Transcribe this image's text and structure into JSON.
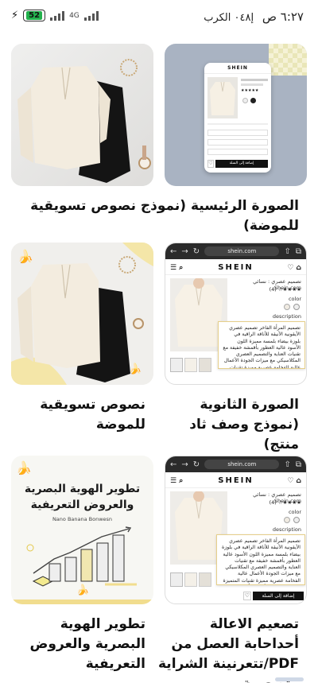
{
  "status_bar": {
    "time": "٦:٢٧ ص",
    "carrier": "إ٠٤٨ الكرب",
    "battery": "52",
    "network": "4G"
  },
  "cards": [
    {
      "id": "main-image",
      "caption": "الصورة الرئيسية (نموذج نصوص تسويقية للموضة)",
      "phone_brand": "SHEIN",
      "buy_label": "إضافة إلى السلة"
    },
    {
      "id": "product-photo-1"
    },
    {
      "id": "secondary-image",
      "caption": "الصورة الثانوية (نموذج وصف ثاد منتج)",
      "url": "shein.com",
      "brand": "SHEIN",
      "product_title": "تصميم عصري : نسائي Shein.com",
      "rating": "★★★★☆ (4)",
      "color_label": "color",
      "description_label": "description",
      "description": "تصميم المرأة الفاخر تصميم عصري الأيقونية الأنيقة للأناقة الراقية في بلوزة بيضاء بلمسة مميزة اللون الأسود عالية العطور بأقمشة خفيفة مع تقنيات العناية والتصميم العصري المكلاسيكي مع ميزات الجودة الأعمال عالية الفخامة عصرية مميزة تقنيات المتميزة تصميم عصري، الأعمال وأناقة عالية التصميم الراقي. الأنيق، أسود."
    },
    {
      "id": "product-photo-2",
      "caption": "نصوص تسويقية للموضة"
    },
    {
      "id": "pdf-design",
      "caption": "تصعيم الاعالة أحداحابة العصل من PDF/تتعرنينة الشراية وتصعرية",
      "url": "shein.com",
      "brand": "SHEIN",
      "product_title": "تصميم عصري : نسائي Shein.com",
      "rating": "★★★★☆ (4)",
      "color_label": "color",
      "description_label": "description",
      "description": "تصميم المرأة الفاخر تصميم عصري الأيقونية الأنيقة للأناقة الراقية في بلوزة بيضاء بلمسة مميزة اللون الأسود عالية العطور بأقمشة خفيفة مع تقنيات العناية والتصميم العصري المكلاسيكي مع ميزات الجودة الأعمال عالية الفخامة عصرية مميزة تقنيات المتميزة تصميم عصري، الأعمال وأناقة عالية التصميم الراقي.",
      "buy_label": "إضافة إلى السلة"
    },
    {
      "id": "visual-identity",
      "caption": "تطوير الهوية البصرية والعروض التعريفية",
      "infographic_title": "تطوير الهوية البصرية والعروض التعريفية",
      "infographic_subtitle": "Nano Banana Bonwesn"
    }
  ],
  "colors": {
    "card1_bg": "#a9b3c2",
    "accent_yellow": "#f4e6a8",
    "battery_green": "#22b14c"
  }
}
